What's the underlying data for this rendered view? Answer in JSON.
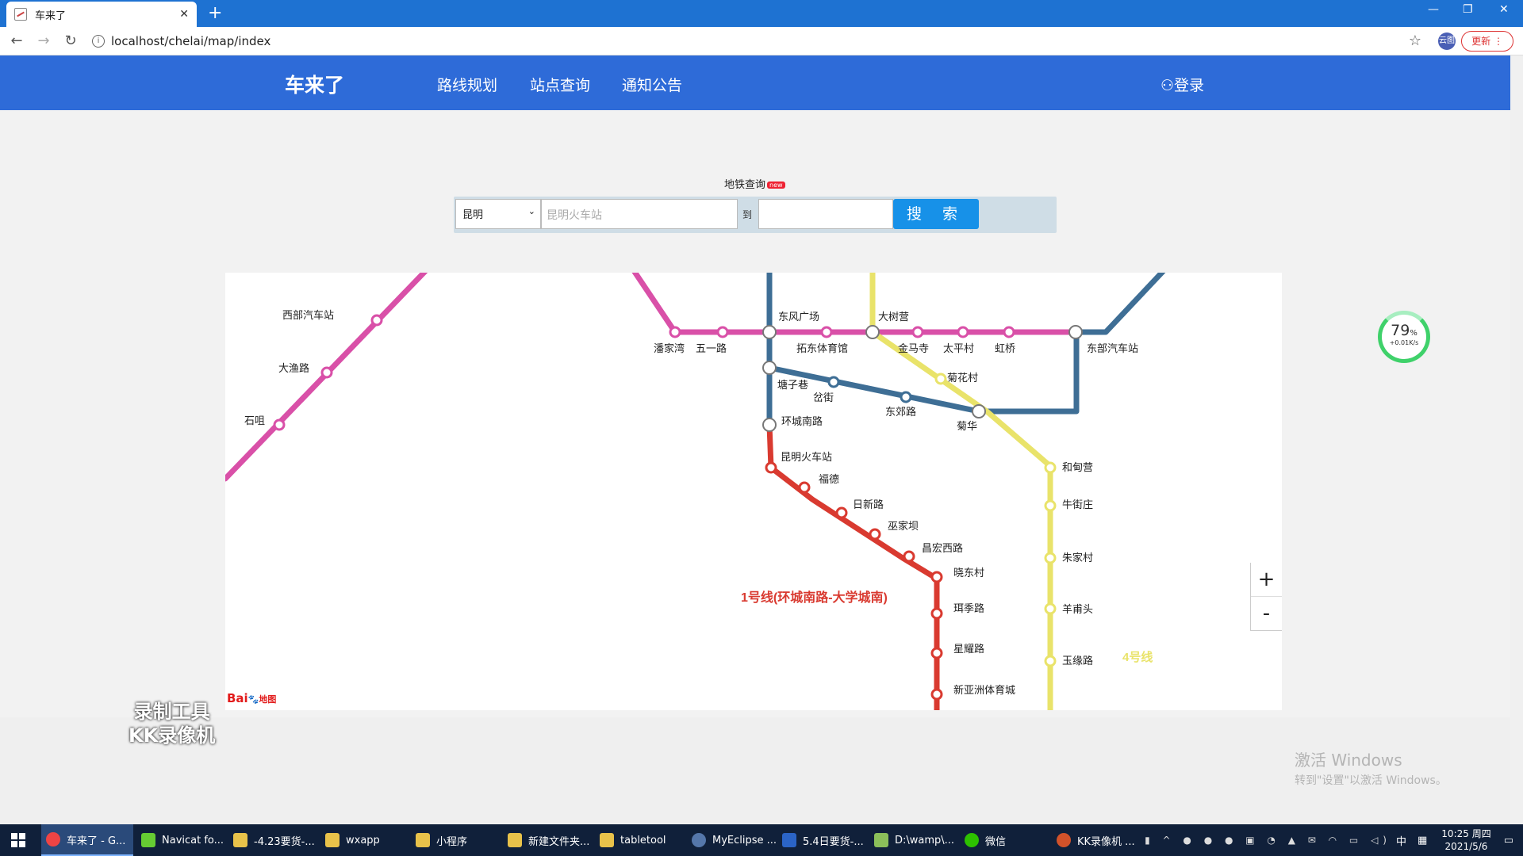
{
  "browser": {
    "tab_title": "车来了",
    "url": "localhost/chelai/map/index",
    "update_label": "更新",
    "profile_label": "云图"
  },
  "site": {
    "brand": "车来了",
    "nav": [
      "路线规划",
      "站点查询",
      "通知公告"
    ],
    "login": "登录"
  },
  "search": {
    "title": "地铁查询",
    "badge": "new",
    "city": "昆明",
    "from_value": "昆明火车站",
    "to_label": "到",
    "to_value": "",
    "button": "搜 索"
  },
  "map": {
    "lines": [
      {
        "name": "1号线(环城南路-大学城南)",
        "color": "#d93a30"
      },
      {
        "name": "4号线",
        "color": "#e9e36a"
      }
    ],
    "line_colors": {
      "magenta": "#d950a8",
      "blue": "#3e6e95",
      "yellow": "#e9e36a",
      "red": "#d93a30"
    },
    "stations": {
      "xibu": "西部汽车站",
      "dayu": "大渔路",
      "shiju": "石咀",
      "dongfeng": "东风广场",
      "dashuying": "大树营",
      "panjiawan": "潘家湾",
      "wuyi": "五一路",
      "tuodong": "拓东体育馆",
      "jinma": "金马寺",
      "taiping": "太平村",
      "hongqiao": "虹桥",
      "dongbu": "东部汽车站",
      "juhuacun": "菊花村",
      "tangzixiang": "塘子巷",
      "gaijie": "岔街",
      "dongjiao": "东郊路",
      "juhua": "菊华",
      "huancheng": "环城南路",
      "hedian": "和甸营",
      "kmhuoche": "昆明火车站",
      "fude": "福德",
      "niujie": "牛街庄",
      "rixin": "日新路",
      "wujia": "巫家坝",
      "changhong": "昌宏西路",
      "xiaodong": "晓东村",
      "zhujia": "朱家村",
      "erji": "珥季路",
      "yangfu": "羊甫头",
      "xingyao": "星耀路",
      "yuyuan": "玉缘路",
      "xinyazhou": "新亚洲体育城"
    },
    "zoom_in": "+",
    "zoom_out": "-",
    "logo": "Bai",
    "logo_suffix": "地图"
  },
  "speed_widget": {
    "percent": "79",
    "percent_unit": "%",
    "rate": "+0.01K/s"
  },
  "recorder_watermark": [
    "录制工具",
    "KK录像机"
  ],
  "activation": {
    "title": "激活 Windows",
    "subtitle": "转到\"设置\"以激活 Windows。"
  },
  "taskbar": {
    "items": [
      "车来了 - G...",
      "Navicat fo...",
      "-4.23要货-...",
      "wxapp",
      "小程序",
      "新建文件夹...",
      "tabletool",
      "MyEclipse ...",
      "5.4日要货-...",
      "D:\\wamp\\...",
      "微信",
      "KK录像机 ..."
    ],
    "ime": "中",
    "time": "10:25 周四",
    "date": "2021/5/6"
  }
}
